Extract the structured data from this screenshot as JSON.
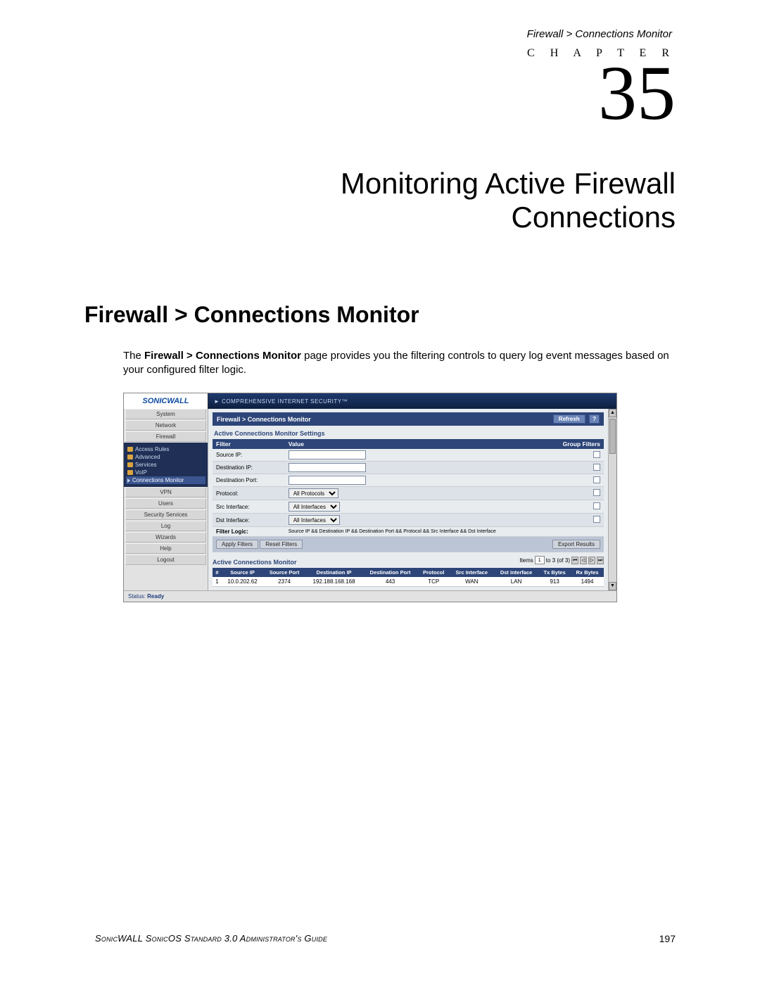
{
  "breadcrumb": "Firewall > Connections Monitor",
  "chapter_label": "C H A P T E R",
  "chapter_number": "35",
  "chapter_title_l1": "Monitoring Active Firewall",
  "chapter_title_l2": "Connections",
  "section_heading": "Firewall > Connections Monitor",
  "body_prefix": "The ",
  "body_bold": "Firewall > Connections Monitor",
  "body_suffix": " page provides you the filtering controls to query log event messages based on your configured filter logic.",
  "screenshot": {
    "logo": "SONICWALL",
    "tagline": "► COMPREHENSIVE INTERNET SECURITY™",
    "side_tabs_top": [
      "System",
      "Network",
      "Firewall"
    ],
    "side_items": [
      {
        "label": "Access Rules",
        "icon": "folder"
      },
      {
        "label": "Advanced",
        "icon": "folder"
      },
      {
        "label": "Services",
        "icon": "folder"
      },
      {
        "label": "VoIP",
        "icon": "folder"
      },
      {
        "label": "Connections Monitor",
        "icon": "arrow",
        "selected": true
      }
    ],
    "side_tabs_bottom": [
      "VPN",
      "Users",
      "Security Services",
      "Log",
      "Wizards",
      "Help",
      "Logout"
    ],
    "pane_title": "Firewall > Connections Monitor",
    "refresh_btn": "Refresh",
    "help_btn": "?",
    "settings_heading": "Active Connections Monitor Settings",
    "filter_col": "Filter",
    "value_col": "Value",
    "group_col": "Group Filters",
    "filters": [
      {
        "label": "Source IP:",
        "type": "input"
      },
      {
        "label": "Destination IP:",
        "type": "input"
      },
      {
        "label": "Destination Port:",
        "type": "input"
      },
      {
        "label": "Protocol:",
        "type": "select",
        "value": "All Protocols"
      },
      {
        "label": "Src Interface:",
        "type": "select",
        "value": "All Interfaces"
      },
      {
        "label": "Dst Interface:",
        "type": "select",
        "value": "All Interfaces"
      }
    ],
    "filter_logic_label": "Filter Logic:",
    "filter_logic_value": "Source IP && Destination IP && Destination Port && Protocol && Src Interface && Dst Interface",
    "apply_btn": "Apply Filters",
    "reset_btn": "Reset Filters",
    "export_btn": "Export Results",
    "monitor_heading": "Active Connections Monitor",
    "pager_items": "Items",
    "pager_from": "1",
    "pager_to_text": "to 3 (of 3)",
    "conn_headers": [
      "#",
      "Source IP",
      "Source Port",
      "Destination IP",
      "Destination Port",
      "Protocol",
      "Src Interface",
      "Dst Interface",
      "Tx Bytes",
      "Rx Bytes"
    ],
    "conn_row": [
      "1",
      "10.0.202.62",
      "2374",
      "192.188.168.168",
      "443",
      "TCP",
      "WAN",
      "LAN",
      "913",
      "1494"
    ],
    "status_label": "Status:",
    "status_value": "Ready"
  },
  "footer_left": "SonicWALL SonicOS Standard 3.0 Administrator's Guide",
  "footer_right": "197"
}
